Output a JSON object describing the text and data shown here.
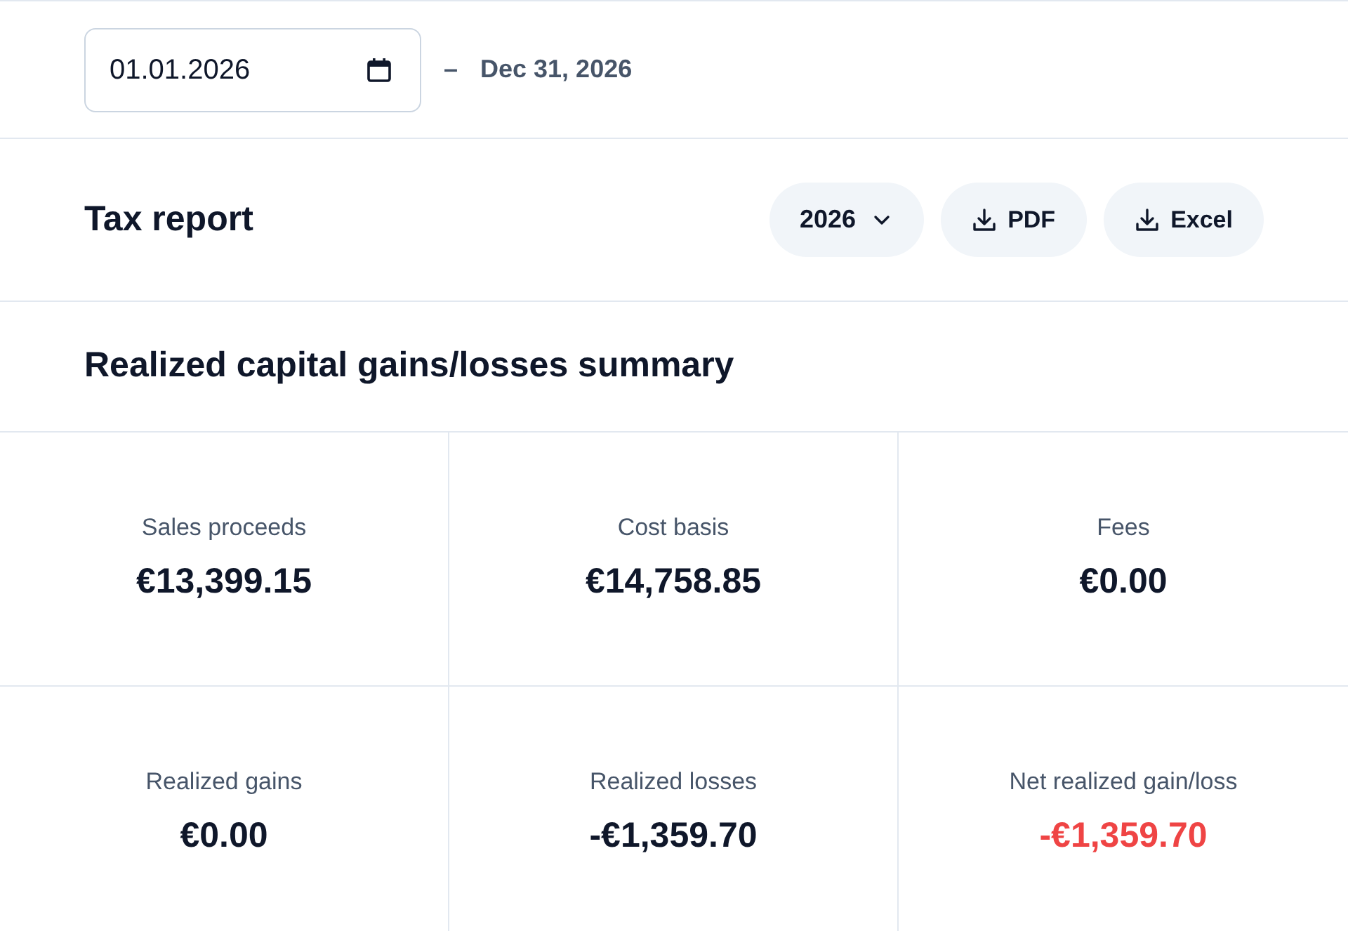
{
  "date_range": {
    "start_field": {
      "value": "01.01.2026"
    },
    "separator": "–",
    "end_date": "Dec 31, 2026"
  },
  "report_header": {
    "title": "Tax report",
    "year_select": {
      "value": "2026"
    },
    "export_buttons": [
      {
        "label": "PDF"
      },
      {
        "label": "Excel"
      }
    ]
  },
  "summary": {
    "title": "Realized capital gains/losses summary",
    "metrics": [
      {
        "label": "Sales proceeds",
        "value": "€13,399.15",
        "color": "#0f172a"
      },
      {
        "label": "Cost basis",
        "value": "€14,758.85",
        "color": "#0f172a"
      },
      {
        "label": "Fees",
        "value": "€0.00",
        "color": "#0f172a"
      },
      {
        "label": "Realized gains",
        "value": "€0.00",
        "color": "#0f172a"
      },
      {
        "label": "Realized losses",
        "value": "-€1,359.70",
        "color": "#0f172a"
      },
      {
        "label": "Net realized gain/loss",
        "value": "-€1,359.70",
        "color": "#ef4444"
      }
    ]
  }
}
